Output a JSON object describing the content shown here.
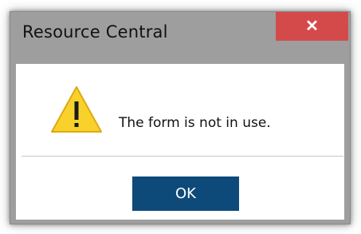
{
  "window": {
    "title": "Resource Central",
    "close_glyph": "✕"
  },
  "content": {
    "message": "The form is not in use.",
    "icon": "warning-triangle-icon"
  },
  "actions": {
    "ok_label": "OK"
  },
  "colors": {
    "frame": "#9e9e9e",
    "close_button": "#d44a4a",
    "ok_button": "#0e4a79",
    "warning_fill": "#f8d22a"
  }
}
